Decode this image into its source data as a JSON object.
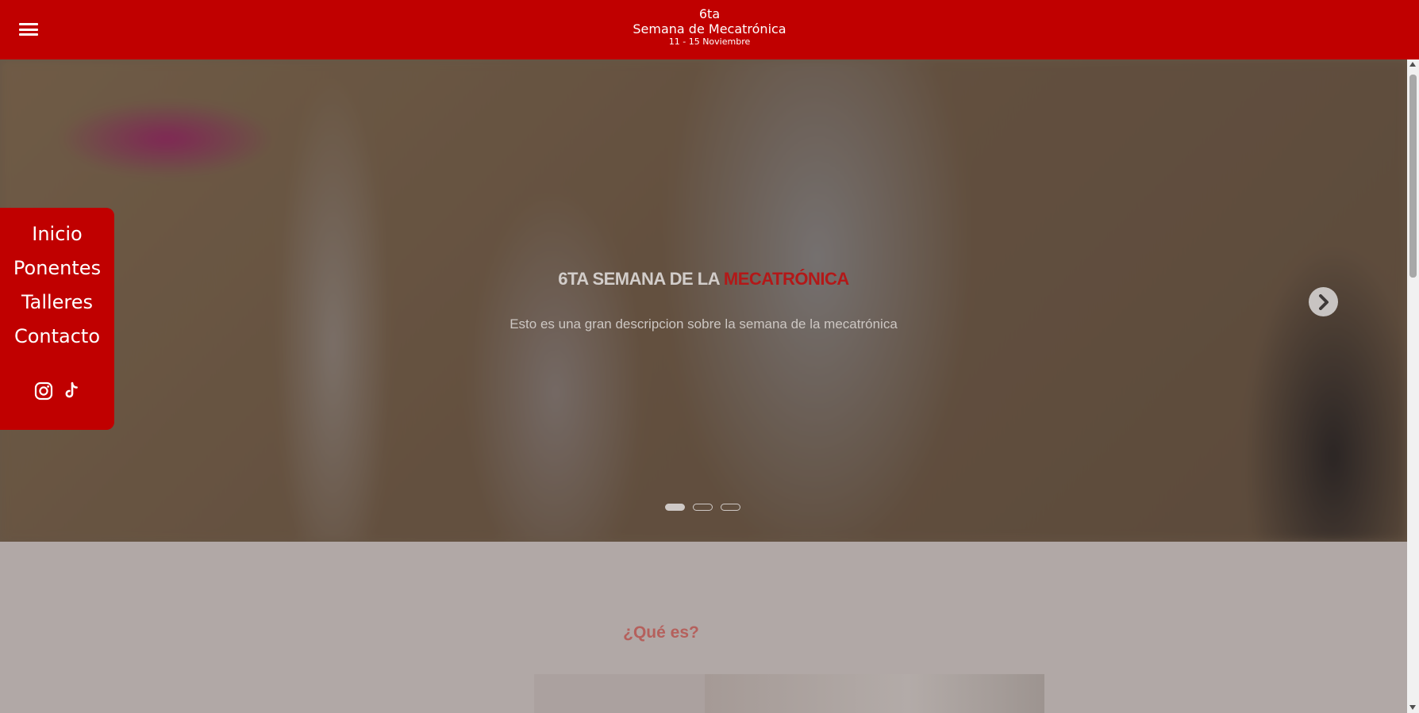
{
  "header": {
    "edition": "6ta",
    "title": "Semana de Mecatrónica",
    "dates": "11 - 15 Noviembre",
    "menu_icon": "hamburger-icon",
    "background": "#c00000"
  },
  "sidebar": {
    "items": [
      {
        "label": "Inicio"
      },
      {
        "label": "Ponentes"
      },
      {
        "label": "Talleres"
      },
      {
        "label": "Contacto"
      }
    ],
    "social": [
      {
        "icon": "instagram-icon"
      },
      {
        "icon": "tiktok-icon"
      }
    ]
  },
  "hero": {
    "title_prefix": "6TA SEMANA DE LA ",
    "title_accent": "MECATRÓNICA",
    "description": "Esto es una gran descripcion sobre la semana de la mecatrónica",
    "next_icon": "chevron-right-icon",
    "slide_count": 3,
    "active_slide": 1
  },
  "about": {
    "title": "¿Qué es?"
  },
  "colors": {
    "accent": "#c00000",
    "accent_text": "#b31818"
  }
}
